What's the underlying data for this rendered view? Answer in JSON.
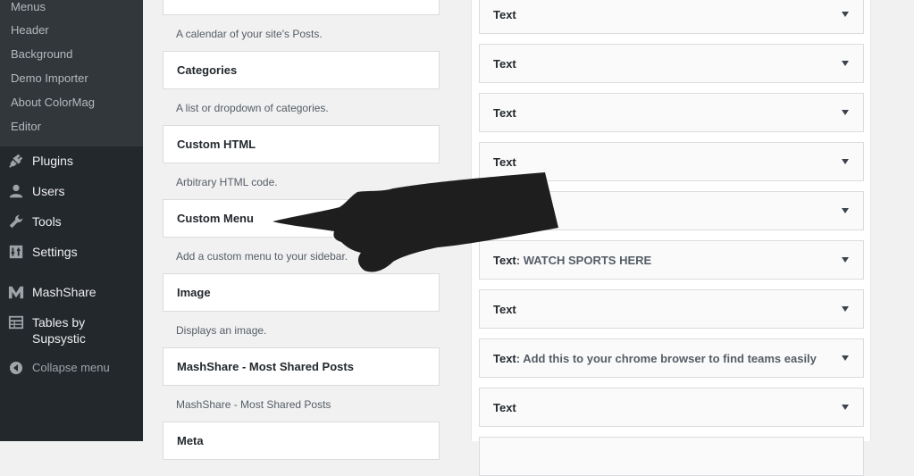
{
  "sidebar": {
    "submenu": [
      {
        "label": "Menus"
      },
      {
        "label": "Header"
      },
      {
        "label": "Background"
      },
      {
        "label": "Demo Importer"
      },
      {
        "label": "About ColorMag"
      },
      {
        "label": "Editor"
      }
    ],
    "menu": [
      {
        "label": "Plugins",
        "icon": "plug-icon"
      },
      {
        "label": "Users",
        "icon": "user-icon"
      },
      {
        "label": "Tools",
        "icon": "wrench-icon"
      },
      {
        "label": "Settings",
        "icon": "settings-icon"
      },
      {
        "label": "MashShare",
        "icon": "mashshare-logo-icon"
      },
      {
        "label": "Tables by Supsystic",
        "icon": "table-icon"
      }
    ],
    "collapse_label": "Collapse menu"
  },
  "available_widgets": {
    "top_desc": "A calendar of your site's Posts.",
    "items": [
      {
        "title": "Categories",
        "desc": "A list or dropdown of categories."
      },
      {
        "title": "Custom HTML",
        "desc": "Arbitrary HTML code."
      },
      {
        "title": "Custom Menu",
        "desc": "Add a custom menu to your sidebar."
      },
      {
        "title": "Image",
        "desc": "Displays an image."
      },
      {
        "title": "MashShare - Most Shared Posts",
        "desc": "MashShare - Most Shared Posts"
      },
      {
        "title": "Meta",
        "desc": ""
      }
    ]
  },
  "sidebar_widgets": [
    {
      "title": "Text",
      "subtitle": ""
    },
    {
      "title": "Text",
      "subtitle": ""
    },
    {
      "title": "Text",
      "subtitle": ""
    },
    {
      "title": "Text",
      "subtitle": ""
    },
    {
      "title": "",
      "subtitle": ""
    },
    {
      "title": "Text",
      "subtitle": ": WATCH SPORTS HERE"
    },
    {
      "title": "Text",
      "subtitle": ""
    },
    {
      "title": "Text",
      "subtitle": ": Add this to your chrome browser to find teams easily"
    },
    {
      "title": "Text",
      "subtitle": ""
    }
  ],
  "colors": {
    "admin_sidebar_bg": "#23282d",
    "admin_submenu_bg": "#32373c",
    "page_bg": "#f1f1f1"
  }
}
